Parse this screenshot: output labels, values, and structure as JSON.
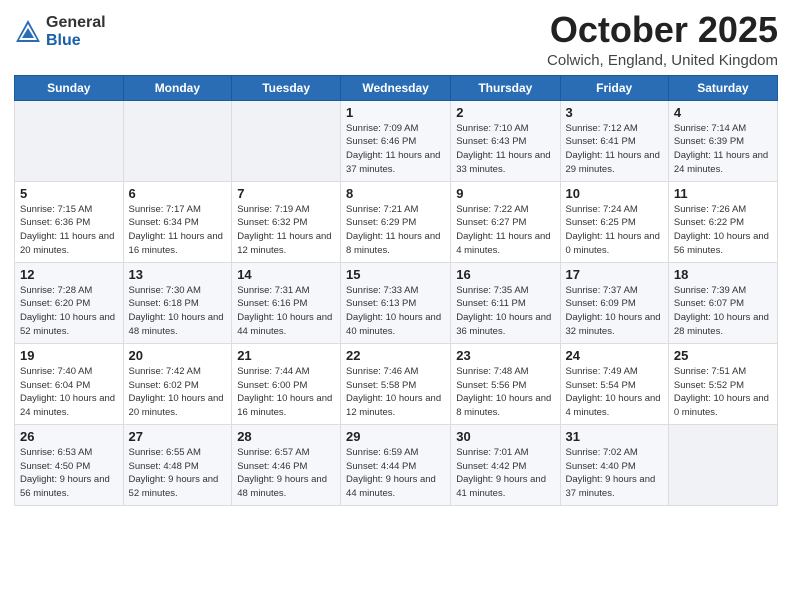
{
  "header": {
    "logo_general": "General",
    "logo_blue": "Blue",
    "month": "October 2025",
    "location": "Colwich, England, United Kingdom"
  },
  "days_of_week": [
    "Sunday",
    "Monday",
    "Tuesday",
    "Wednesday",
    "Thursday",
    "Friday",
    "Saturday"
  ],
  "weeks": [
    [
      {
        "num": "",
        "info": ""
      },
      {
        "num": "",
        "info": ""
      },
      {
        "num": "",
        "info": ""
      },
      {
        "num": "1",
        "info": "Sunrise: 7:09 AM\nSunset: 6:46 PM\nDaylight: 11 hours and 37 minutes."
      },
      {
        "num": "2",
        "info": "Sunrise: 7:10 AM\nSunset: 6:43 PM\nDaylight: 11 hours and 33 minutes."
      },
      {
        "num": "3",
        "info": "Sunrise: 7:12 AM\nSunset: 6:41 PM\nDaylight: 11 hours and 29 minutes."
      },
      {
        "num": "4",
        "info": "Sunrise: 7:14 AM\nSunset: 6:39 PM\nDaylight: 11 hours and 24 minutes."
      }
    ],
    [
      {
        "num": "5",
        "info": "Sunrise: 7:15 AM\nSunset: 6:36 PM\nDaylight: 11 hours and 20 minutes."
      },
      {
        "num": "6",
        "info": "Sunrise: 7:17 AM\nSunset: 6:34 PM\nDaylight: 11 hours and 16 minutes."
      },
      {
        "num": "7",
        "info": "Sunrise: 7:19 AM\nSunset: 6:32 PM\nDaylight: 11 hours and 12 minutes."
      },
      {
        "num": "8",
        "info": "Sunrise: 7:21 AM\nSunset: 6:29 PM\nDaylight: 11 hours and 8 minutes."
      },
      {
        "num": "9",
        "info": "Sunrise: 7:22 AM\nSunset: 6:27 PM\nDaylight: 11 hours and 4 minutes."
      },
      {
        "num": "10",
        "info": "Sunrise: 7:24 AM\nSunset: 6:25 PM\nDaylight: 11 hours and 0 minutes."
      },
      {
        "num": "11",
        "info": "Sunrise: 7:26 AM\nSunset: 6:22 PM\nDaylight: 10 hours and 56 minutes."
      }
    ],
    [
      {
        "num": "12",
        "info": "Sunrise: 7:28 AM\nSunset: 6:20 PM\nDaylight: 10 hours and 52 minutes."
      },
      {
        "num": "13",
        "info": "Sunrise: 7:30 AM\nSunset: 6:18 PM\nDaylight: 10 hours and 48 minutes."
      },
      {
        "num": "14",
        "info": "Sunrise: 7:31 AM\nSunset: 6:16 PM\nDaylight: 10 hours and 44 minutes."
      },
      {
        "num": "15",
        "info": "Sunrise: 7:33 AM\nSunset: 6:13 PM\nDaylight: 10 hours and 40 minutes."
      },
      {
        "num": "16",
        "info": "Sunrise: 7:35 AM\nSunset: 6:11 PM\nDaylight: 10 hours and 36 minutes."
      },
      {
        "num": "17",
        "info": "Sunrise: 7:37 AM\nSunset: 6:09 PM\nDaylight: 10 hours and 32 minutes."
      },
      {
        "num": "18",
        "info": "Sunrise: 7:39 AM\nSunset: 6:07 PM\nDaylight: 10 hours and 28 minutes."
      }
    ],
    [
      {
        "num": "19",
        "info": "Sunrise: 7:40 AM\nSunset: 6:04 PM\nDaylight: 10 hours and 24 minutes."
      },
      {
        "num": "20",
        "info": "Sunrise: 7:42 AM\nSunset: 6:02 PM\nDaylight: 10 hours and 20 minutes."
      },
      {
        "num": "21",
        "info": "Sunrise: 7:44 AM\nSunset: 6:00 PM\nDaylight: 10 hours and 16 minutes."
      },
      {
        "num": "22",
        "info": "Sunrise: 7:46 AM\nSunset: 5:58 PM\nDaylight: 10 hours and 12 minutes."
      },
      {
        "num": "23",
        "info": "Sunrise: 7:48 AM\nSunset: 5:56 PM\nDaylight: 10 hours and 8 minutes."
      },
      {
        "num": "24",
        "info": "Sunrise: 7:49 AM\nSunset: 5:54 PM\nDaylight: 10 hours and 4 minutes."
      },
      {
        "num": "25",
        "info": "Sunrise: 7:51 AM\nSunset: 5:52 PM\nDaylight: 10 hours and 0 minutes."
      }
    ],
    [
      {
        "num": "26",
        "info": "Sunrise: 6:53 AM\nSunset: 4:50 PM\nDaylight: 9 hours and 56 minutes."
      },
      {
        "num": "27",
        "info": "Sunrise: 6:55 AM\nSunset: 4:48 PM\nDaylight: 9 hours and 52 minutes."
      },
      {
        "num": "28",
        "info": "Sunrise: 6:57 AM\nSunset: 4:46 PM\nDaylight: 9 hours and 48 minutes."
      },
      {
        "num": "29",
        "info": "Sunrise: 6:59 AM\nSunset: 4:44 PM\nDaylight: 9 hours and 44 minutes."
      },
      {
        "num": "30",
        "info": "Sunrise: 7:01 AM\nSunset: 4:42 PM\nDaylight: 9 hours and 41 minutes."
      },
      {
        "num": "31",
        "info": "Sunrise: 7:02 AM\nSunset: 4:40 PM\nDaylight: 9 hours and 37 minutes."
      },
      {
        "num": "",
        "info": ""
      }
    ]
  ]
}
